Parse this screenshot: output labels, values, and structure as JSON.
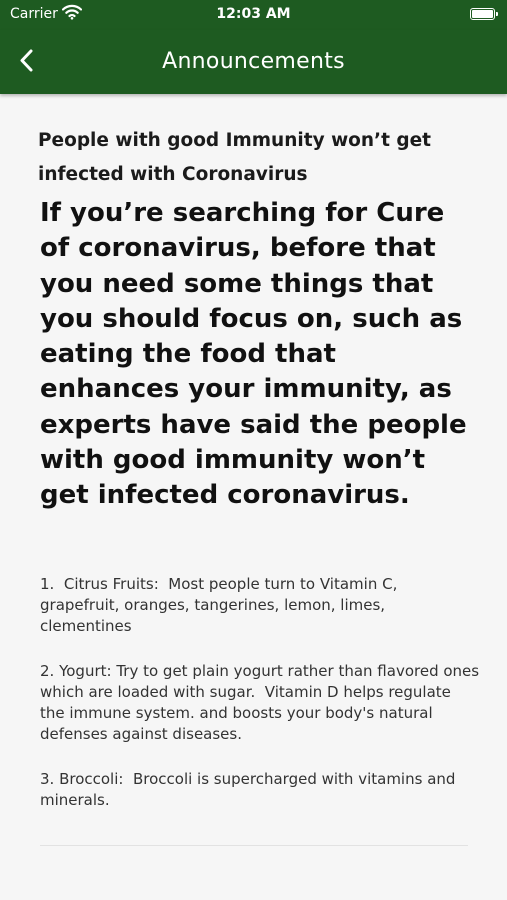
{
  "status_bar": {
    "carrier": "Carrier",
    "time": "12:03 AM"
  },
  "nav": {
    "title": "Announcements",
    "back_icon": "chevron-left-icon",
    "background_color": "#1e5b21"
  },
  "article": {
    "subtitle": "People with good Immunity won’t get infected with Coronavirus",
    "headline": "If you’re searching for Cure of coronavirus, before that you need some things that you should focus on, such as eating the food that enhances your immunity, as experts have said the people with good immunity won’t get infected coronavirus.",
    "items": [
      "1.  Citrus Fruits:  Most people turn to Vitamin C, grapefruit, oranges, tangerines, lemon, limes, clementines",
      "2. Yogurt: Try to get plain yogurt rather than flavored ones which are loaded with sugar.  Vitamin D helps regulate the immune system. and boosts your body's natural defenses against diseases.",
      "3. Broccoli:  Broccoli is supercharged with vitamins and minerals."
    ]
  }
}
